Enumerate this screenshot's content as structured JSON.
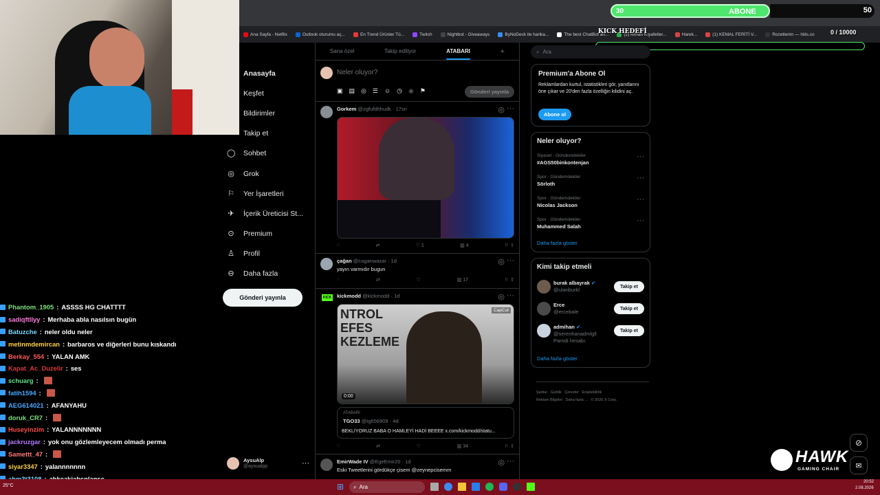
{
  "overlay": {
    "abone_count": "30",
    "abone_label": "ABONE",
    "abone_goal": "50",
    "kick_label": "KICK HEDEFİ",
    "kick_value": "0 / 10000",
    "brand": "HAWK",
    "brand_sub": "GAMING CHAIR"
  },
  "browser": {
    "address_hint": "Rozetlerim",
    "bookmarks": [
      "Ana Sayfa - Netflix",
      "Outlook oturumu aç...",
      "En Trend Ürünler Tü...",
      "Twitch",
      "Nightbot - Giveaways",
      "ByNoDeck ile harika...",
      "The best ChatBot an...",
      "(2) Alınan Kıyafetler...",
      "Harek...",
      "(1) KEMAL FERİTİ V...",
      "Rozetlerim — hiits.co"
    ]
  },
  "chat": [
    {
      "user": "Phantom_1905",
      "text": "ASSSS HG CHATTTT",
      "color": "#7fe07f"
    },
    {
      "user": "sadiqftllyy",
      "text": "Merhaba abla nasılsın bugün",
      "color": "#ff7ad9"
    },
    {
      "user": "Batuzche",
      "text": "neler oldu neler",
      "color": "#7ad8ff"
    },
    {
      "user": "metinmdemircan",
      "text": "barbaros ve diğerleri bunu kıskandı",
      "color": "#ffd24a"
    },
    {
      "user": "Berkay_554",
      "text": "YALAN AMK",
      "color": "#ff5a5a"
    },
    {
      "user": "Kapat_Ac_Duzelir",
      "text": "ses",
      "color": "#d43c3c"
    },
    {
      "user": "schuarg",
      "text": "",
      "color": "#5ee08a"
    },
    {
      "user": "fatih1594",
      "text": "",
      "color": "#4aa8ff"
    },
    {
      "user": "AEG614021",
      "text": "AFANYAHU",
      "color": "#4aa8ff"
    },
    {
      "user": "doruk_CR7",
      "text": "",
      "color": "#7fe07f"
    },
    {
      "user": "Huseyinzim",
      "text": "YALANNNNNNN",
      "color": "#ff4a4a"
    },
    {
      "user": "jackruzgar",
      "text": "yok onu gözlemleyecem olmadı perma",
      "color": "#b27aff"
    },
    {
      "user": "Samettt_47",
      "text": "",
      "color": "#ff7a7a"
    },
    {
      "user": "siyar3347",
      "text": "yalannnnnnn",
      "color": "#ffd24a"
    },
    {
      "user": "ahm3t3108",
      "text": "abkcakjabsnlansc",
      "color": "#7ad8ff"
    }
  ],
  "nav": {
    "items": [
      "Anasayfa",
      "Keşfet",
      "Bildirimler",
      "Takip et",
      "Sohbet",
      "Grok",
      "Yer İşaretleri",
      "İçerik Üreticisi St...",
      "Premium",
      "Profil",
      "Daha fazla"
    ],
    "post_button": "Gönderi yayınla",
    "account_name": "AysuAlp",
    "account_handle": "@aysualpp"
  },
  "timeline": {
    "tabs": [
      "Sana özel",
      "Takip ediliyor",
      "ATABARI"
    ],
    "compose_placeholder": "Neler oluyor?",
    "compose_button": "Gönderi yayınla",
    "tweets": [
      {
        "name": "Gorkem",
        "handle": "@zgfufdhhudk",
        "time": "17sn",
        "text": "",
        "replies": "",
        "retweets": "",
        "likes": "1",
        "views": "4"
      },
      {
        "name": "çağan",
        "handle": "@caganwaxar",
        "time": "1d",
        "text": "yayın varmıdır bugun",
        "replies": "",
        "retweets": "",
        "likes": "",
        "views": "17"
      },
      {
        "name": "kickmodd",
        "handle": "@kickmodd",
        "time": "1d",
        "text": "",
        "video_time": "0:00",
        "video_badge": "CapCut",
        "quote_label": "ATABARI",
        "quote_name": "TGO33",
        "quote_handle": "@tg656909",
        "quote_time": "4d",
        "quote_text": "BEKLİYORUZ BABA O HAMLEYİ HADİ BEEEE x.com/kickmodd/statu...",
        "replies": "",
        "retweets": "",
        "likes": "",
        "views": "34"
      },
      {
        "name": "EmirWade IV",
        "handle": "@EgeEmir20",
        "time": "1d",
        "text": "Eski Tweetlerini gördükçe çisem @zeynepcisemm"
      }
    ]
  },
  "right": {
    "search_placeholder": "Ara",
    "premium_title": "Premium'a Abone Ol",
    "premium_text": "Reklamlardan kurtul, istatistikleri gör, yanıtlarını öne çıkar ve 20'den fazla özelliğin kilidini aç.",
    "premium_button": "Abone ol",
    "trends_title": "Neler oluyor?",
    "trends": [
      {
        "context": "Siyaset · Gündemdekiler",
        "name": "#AGS50binkontenjan"
      },
      {
        "context": "Spor · Gündemdekiler",
        "name": "Sörloth"
      },
      {
        "context": "Spor · Gündemdekiler",
        "name": "Nicolas Jackson"
      },
      {
        "context": "Spor · Gündemdekiler",
        "name": "Muhammed Salah"
      }
    ],
    "trends_more": "Daha fazla göster",
    "who_title": "Kimi takip etmeli",
    "who": [
      {
        "name": "burak albayrak",
        "handle": "@ulariburkl",
        "extra": "",
        "button": "Takip et"
      },
      {
        "name": "Erce",
        "handle": "@ercebale",
        "extra": "",
        "button": "Takip et"
      },
      {
        "name": "admihan",
        "handle": "@serenhanadmlgll",
        "extra": "Parodi hesabı",
        "button": "Takip et"
      }
    ],
    "who_more": "Daha fazla göster",
    "footer": [
      "Şartlar",
      "Gizlilik",
      "Çerezler",
      "Erişilebilirlik",
      "Reklam Bilgileri",
      "Daha fazla ...",
      "© 2026 X Corp."
    ]
  },
  "taskbar": {
    "search": "Ara",
    "time": "20:52",
    "date": "2.08.2026",
    "weather": "25°C"
  }
}
